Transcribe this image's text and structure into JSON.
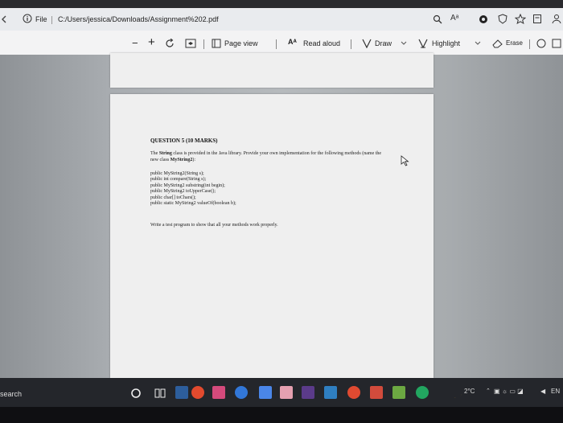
{
  "browser": {
    "file_label": "File",
    "address": "C:/Users/jessica/Downloads/Assignment%202.pdf"
  },
  "toolbar": {
    "minus": "−",
    "plus": "+",
    "page_view": "Page view",
    "read_aloud": "Read aloud",
    "draw": "Draw",
    "highlight": "Highlight",
    "erase": "Erase"
  },
  "document": {
    "question_title": "QUESTION 5 (10 MARKS)",
    "intro_prefix": "The",
    "intro_string_class": "String",
    "intro_rest": "class is provided in the Java library. Provide your own implementation for the following methods (name the new class",
    "intro_class_name": "MyString2",
    "intro_suffix": "):",
    "methods": [
      "public MyString2(String s);",
      "public int compare(String s);",
      "public MyString2 substring(int begin);",
      "public MyString2 toUpperCase();",
      "public char[] toChars();",
      "public static MyString2 valueOf(boolean b);"
    ],
    "closing": "Write a test program to show that all your methods work properly."
  },
  "taskbar": {
    "search_placeholder": "search",
    "weather": "2°C",
    "language": "EN"
  }
}
